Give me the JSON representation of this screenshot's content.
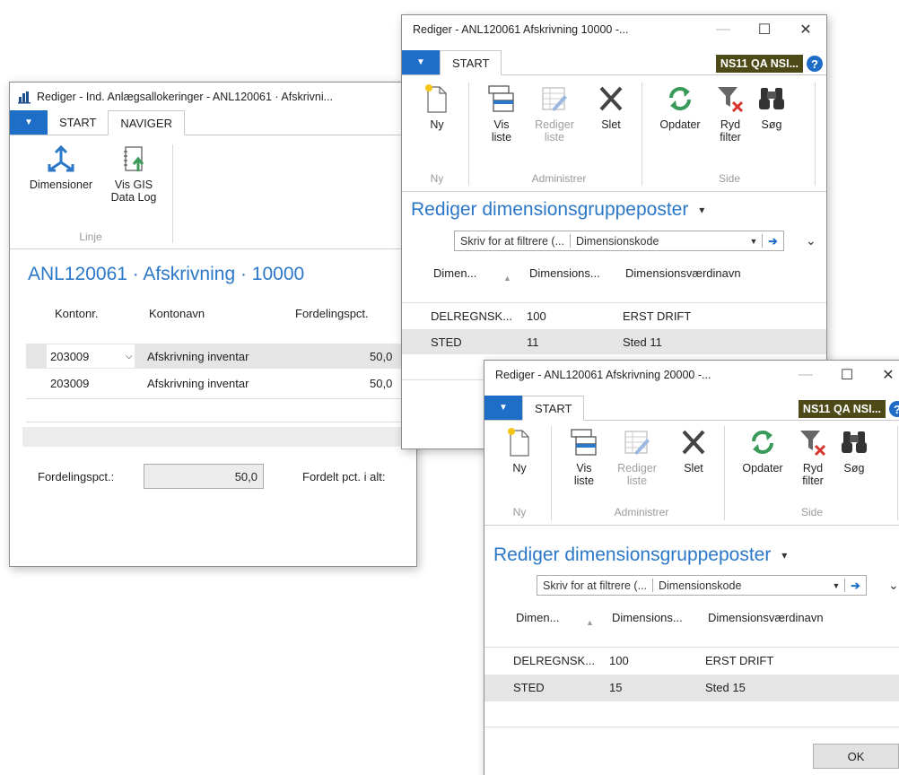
{
  "win1": {
    "title": "Rediger - Ind. Anlægsallokeringer - ANL120061 · Afskrivni...",
    "tabs": [
      "START",
      "NAVIGER"
    ],
    "ribbon": {
      "dimensioner": "Dimensioner",
      "vis_gis_line1": "Vis GIS",
      "vis_gis_line2": "Data Log",
      "group": "Linje"
    },
    "page_title": "ANL120061 · Afskrivning · 10000",
    "columns": [
      "Kontonr.",
      "Kontonavn",
      "Fordelingspct."
    ],
    "rows": [
      {
        "konto": "203009",
        "navn": "Afskrivning inventar",
        "pct": "50,0"
      },
      {
        "konto": "203009",
        "navn": "Afskrivning inventar",
        "pct": "50,0"
      }
    ],
    "footer": {
      "label1": "Fordelingspct.:",
      "value1": "50,0",
      "label2": "Fordelt pct. i alt:"
    }
  },
  "win2": {
    "title": "Rediger - ANL120061 Afskrivning 10000 -...",
    "tab": "START",
    "company": "NS11 QA NSI...",
    "ribbon": {
      "ny": "Ny",
      "vis1": "Vis",
      "vis2": "liste",
      "red1": "Rediger",
      "red2": "liste",
      "slet": "Slet",
      "opdater": "Opdater",
      "ryd1": "Ryd",
      "ryd2": "filter",
      "sog": "Søg",
      "g_ny": "Ny",
      "g_adm": "Administrer",
      "g_side": "Side"
    },
    "page_title": "Rediger dimensionsgruppeposter",
    "filter_placeholder": "Skriv for at filtrere (...",
    "filter_field": "Dimensionskode",
    "columns": [
      "Dimen...",
      "Dimensions...",
      "Dimensionsværdinavn"
    ],
    "rows": [
      {
        "kode": "DELREGNSK...",
        "vaerdi": "100",
        "navn": "ERST DRIFT"
      },
      {
        "kode": "STED",
        "vaerdi": "11",
        "navn": "Sted 11"
      }
    ]
  },
  "win3": {
    "title": "Rediger - ANL120061 Afskrivning 20000 -...",
    "tab": "START",
    "company": "NS11 QA NSI...",
    "ribbon": {
      "ny": "Ny",
      "vis1": "Vis",
      "vis2": "liste",
      "red1": "Rediger",
      "red2": "liste",
      "slet": "Slet",
      "opdater": "Opdater",
      "ryd1": "Ryd",
      "ryd2": "filter",
      "sog": "Søg",
      "g_ny": "Ny",
      "g_adm": "Administrer",
      "g_side": "Side"
    },
    "page_title": "Rediger dimensionsgruppeposter",
    "filter_placeholder": "Skriv for at filtrere (...",
    "filter_field": "Dimensionskode",
    "columns": [
      "Dimen...",
      "Dimensions...",
      "Dimensionsværdinavn"
    ],
    "rows": [
      {
        "kode": "DELREGNSK...",
        "vaerdi": "100",
        "navn": "ERST DRIFT"
      },
      {
        "kode": "STED",
        "vaerdi": "15",
        "navn": "Sted 15"
      }
    ],
    "ok": "OK"
  },
  "colors": {
    "accent": "#1e6ec8",
    "title_blue": "#2b77c8",
    "company_bg": "#4d4a18"
  }
}
